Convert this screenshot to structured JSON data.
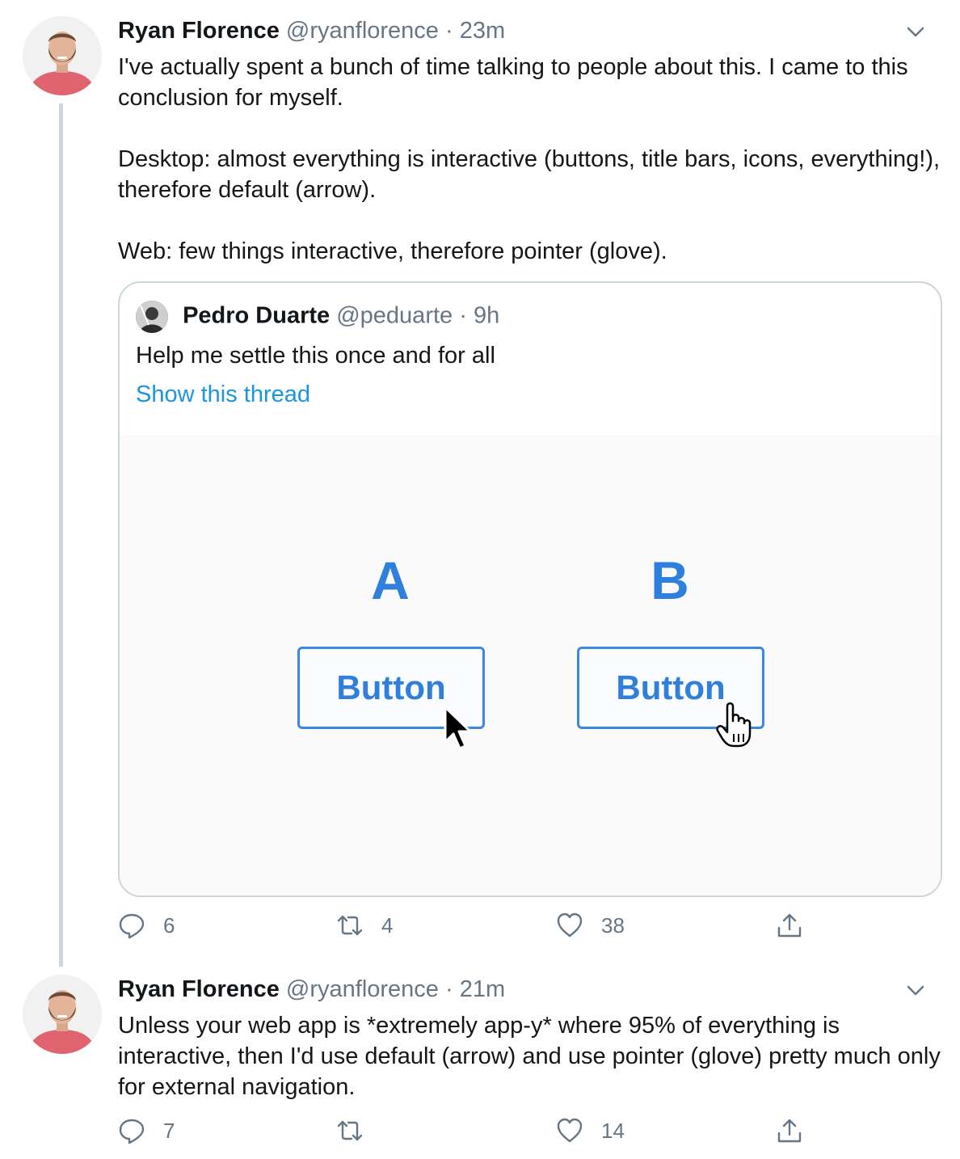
{
  "tweet1": {
    "name": "Ryan Florence",
    "handle": "@ryanflorence",
    "separator": "·",
    "time": "23m",
    "text": "I've actually spent a bunch of time talking to people about this. I came to this conclusion for myself.\n\nDesktop: almost everything is interactive (buttons, title bars, icons, everything!), therefore default (arrow).\n\nWeb: few things interactive, therefore pointer (glove).",
    "quote": {
      "name": "Pedro Duarte",
      "handle": "@peduarte",
      "separator": "·",
      "time": "9h",
      "text": "Help me settle this once and for all",
      "link": "Show this thread",
      "media": {
        "option_a": {
          "letter": "A",
          "button": "Button"
        },
        "option_b": {
          "letter": "B",
          "button": "Button"
        }
      }
    },
    "actions": {
      "replies": "6",
      "retweets": "4",
      "likes": "38"
    }
  },
  "tweet2": {
    "name": "Ryan Florence",
    "handle": "@ryanflorence",
    "separator": "·",
    "time": "21m",
    "text": "Unless your web app is *extremely app-y* where 95% of everything is interactive, then I'd use default (arrow) and use pointer (glove) pretty much only for external navigation.",
    "actions": {
      "replies": "7",
      "retweets": "",
      "likes": "14"
    }
  },
  "icons": [
    "avatar",
    "chevron-down-icon",
    "reply-icon",
    "retweet-icon",
    "like-icon",
    "share-icon",
    "arrow-cursor-icon",
    "hand-cursor-icon"
  ],
  "colors": {
    "link": "#1b95e0",
    "muted": "#657786",
    "border": "#ccd6dd",
    "media_accent": "#2f7fdc"
  }
}
